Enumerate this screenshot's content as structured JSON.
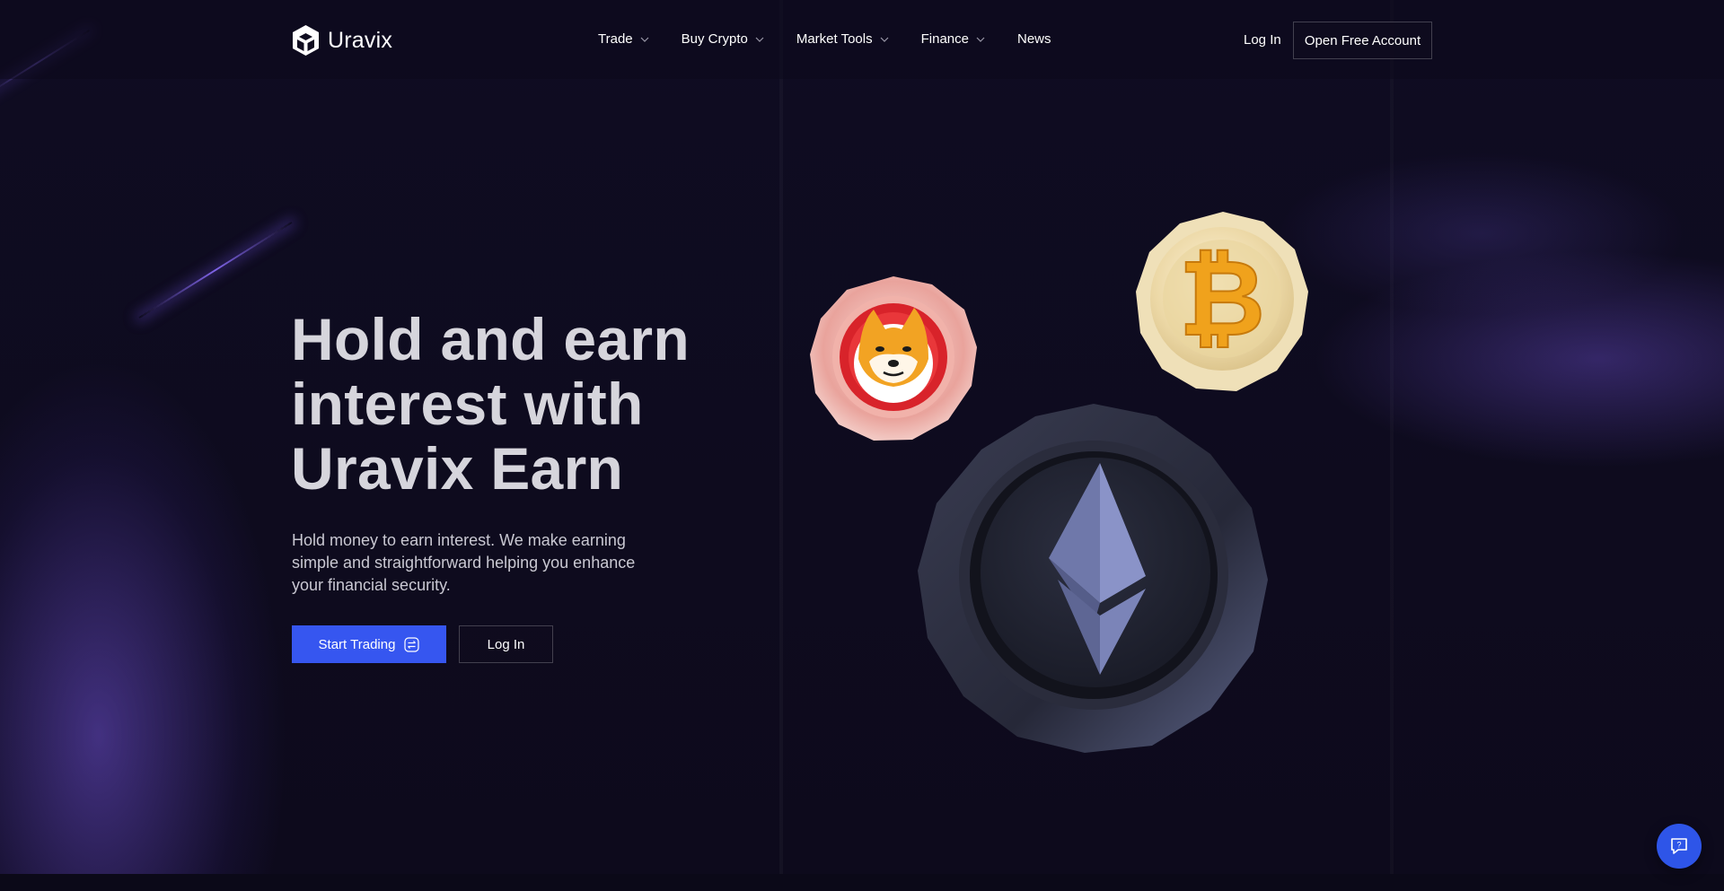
{
  "brand": {
    "name": "Uravix",
    "logo_icon": "cube-logo-icon"
  },
  "nav": {
    "items": [
      {
        "label": "Trade",
        "has_dropdown": true
      },
      {
        "label": "Buy Crypto",
        "has_dropdown": true
      },
      {
        "label": "Market Tools",
        "has_dropdown": true
      },
      {
        "label": "Finance",
        "has_dropdown": true
      },
      {
        "label": "News",
        "has_dropdown": false
      }
    ],
    "login_label": "Log In",
    "open_account_label": "Open Free Account"
  },
  "hero": {
    "title_line1": "Hold and earn",
    "title_line2": "interest with",
    "title_line3": "Uravix Earn",
    "subtitle": "Hold money to earn interest. We make earning simple and straightforward helping you enhance your financial security.",
    "primary_button": "Start Trading",
    "primary_button_icon": "exchange-icon",
    "secondary_button": "Log In"
  },
  "coins": [
    "shiba-inu-coin",
    "bitcoin-coin",
    "ethereum-coin"
  ],
  "chat": {
    "icon": "chat-help-icon"
  },
  "colors": {
    "background": "#0f0c1f",
    "accent": "#3656f0",
    "title_text": "#d6d5dc",
    "body_text": "#c9c8d2"
  }
}
